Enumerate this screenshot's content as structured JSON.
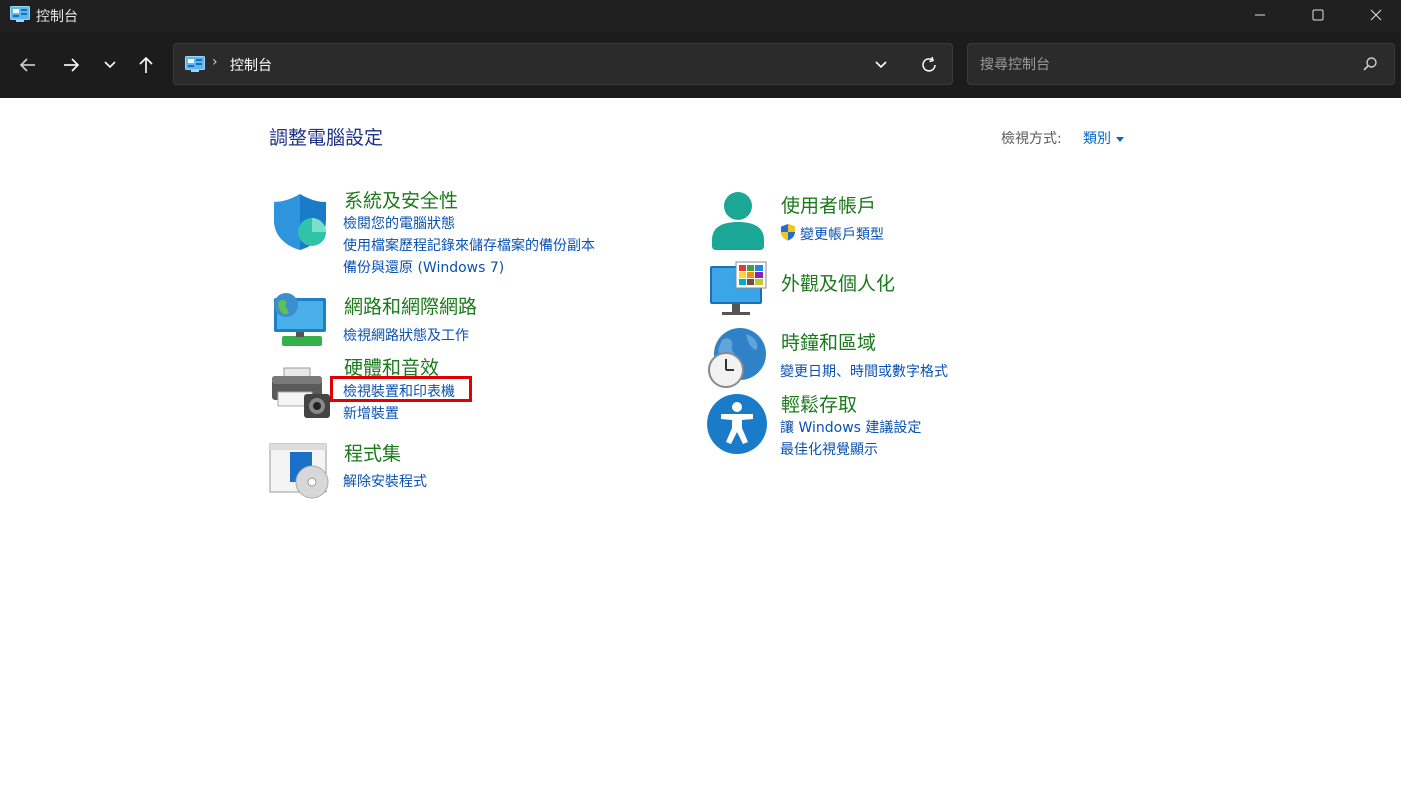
{
  "window": {
    "title": "控制台",
    "accent": "#202020"
  },
  "address_bar": {
    "crumb": "控制台",
    "separator": "›"
  },
  "search": {
    "placeholder": "搜尋控制台"
  },
  "header": {
    "title": "調整電腦設定",
    "view_by_label": "檢視方式:",
    "view_by_value": "類別"
  },
  "categories": {
    "system_security": {
      "title": "系統及安全性",
      "links": [
        "檢閱您的電腦狀態",
        "使用檔案歷程記錄來儲存檔案的備份副本",
        "備份與還原 (Windows 7)"
      ]
    },
    "network": {
      "title": "網路和網際網路",
      "links": [
        "檢視網路狀態及工作"
      ]
    },
    "hardware": {
      "title": "硬體和音效",
      "links": [
        "檢視裝置和印表機",
        "新增裝置"
      ]
    },
    "programs": {
      "title": "程式集",
      "links": [
        "解除安裝程式"
      ]
    },
    "user_accounts": {
      "title": "使用者帳戶",
      "links": [
        "變更帳戶類型"
      ]
    },
    "appearance": {
      "title": "外觀及個人化",
      "links": []
    },
    "clock_region": {
      "title": "時鐘和區域",
      "links": [
        "變更日期、時間或數字格式"
      ]
    },
    "ease_of_access": {
      "title": "輕鬆存取",
      "links": [
        "讓 Windows 建議設定",
        "最佳化視覺顯示"
      ]
    }
  },
  "colors": {
    "category_title": "#1b7a1b",
    "link": "#0a52b3",
    "highlight": "#e00000"
  }
}
